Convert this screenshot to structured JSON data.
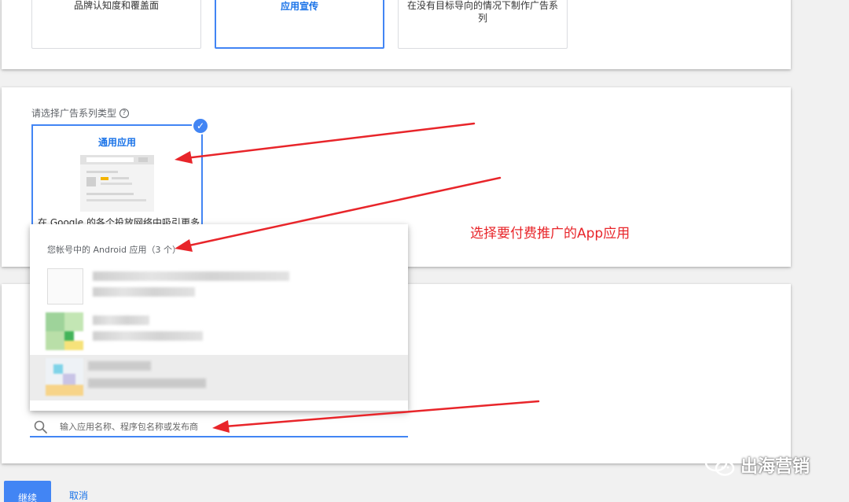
{
  "goals": [
    {
      "label": "品牌认知度和覆盖面",
      "selected": false
    },
    {
      "label": "应用宣传",
      "selected": true
    },
    {
      "label": "在没有目标导向的情况下制作广告系列",
      "selected": false
    }
  ],
  "campaign_type": {
    "prompt": "请选择广告系列类型",
    "help_icon": "help-circle-icon",
    "option_title": "通用应用",
    "option_description": "在 Google 的各个投放网络中吸引更多",
    "selected_icon": "check-icon"
  },
  "app_picker": {
    "header": "您帐号中的 Android 应用（3 个）",
    "search_placeholder": "输入应用名称、程序包名称或发布商",
    "search_icon": "search-icon"
  },
  "annotation": "选择要付费推广的App应用",
  "actions": {
    "continue_label": "继续",
    "cancel_label": "取消"
  },
  "watermark": {
    "text": "出海营销",
    "icon": "wechat-icon"
  },
  "colors": {
    "accent": "#4285f4",
    "annotation": "#e8252a"
  }
}
